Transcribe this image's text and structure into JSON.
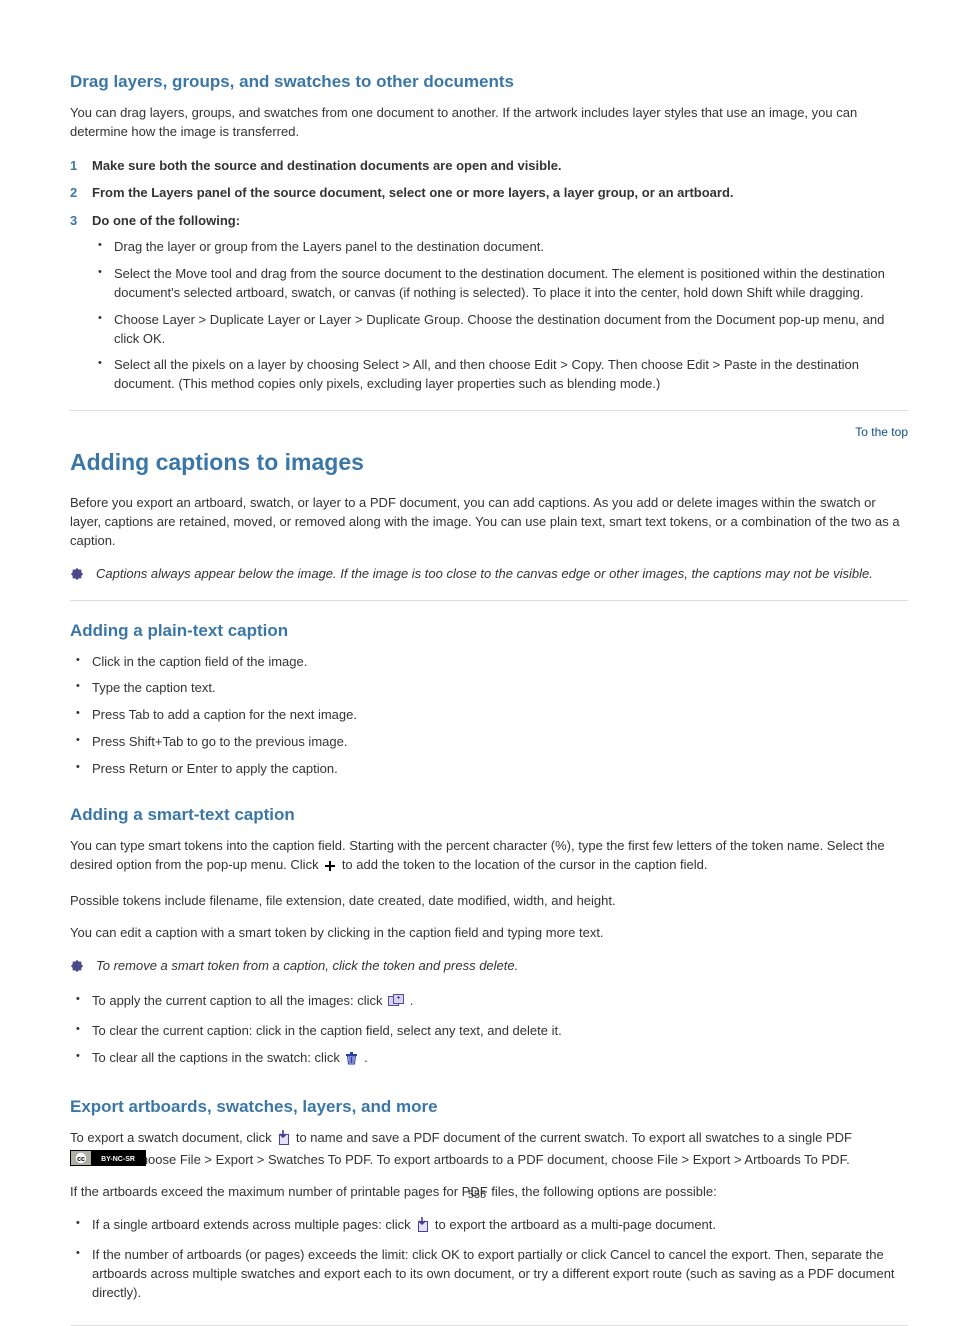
{
  "page_number": "555",
  "s1": {
    "title": "Drag layers, groups, and swatches to other documents",
    "intro": "You can drag layers, groups, and swatches from one document to another. If the artwork includes layer styles that use an image, you can determine how the image is transferred.",
    "steps": {
      "1": "Make sure both the source and destination documents are open and visible.",
      "2": "From the Layers panel of the source document, select one or more layers, a layer group, or an artboard.",
      "3": "Do one of the following:"
    },
    "substeps": [
      "Drag the layer or group from the Layers panel to the destination document.",
      "Select the Move tool and drag from the source document to the destination document. The element is positioned within the destination document's selected artboard, swatch, or canvas (if nothing is selected). To place it into the center, hold down Shift while dragging.",
      "Choose Layer > Duplicate Layer or Layer > Duplicate Group. Choose the destination document from the Document pop-up menu, and click OK.",
      "Select all the pixels on a layer by choosing Select > All, and then choose Edit > Copy. Then choose Edit > Paste in the destination document. (This method copies only pixels, excluding layer properties such as blending mode.)"
    ]
  },
  "top_link": "To the top",
  "s2": {
    "title": "Adding captions to images",
    "p1": "Before you export an artboard, swatch, or layer to a PDF document, you can add captions. As you add or delete images within the swatch or layer, captions are retained, moved, or removed along with the image. You can use plain text, smart text tokens, or a combination of the two as a caption.",
    "note": "Captions always appear below the image. If the image is too close to the canvas edge or other images, the captions may not be visible."
  },
  "s3": {
    "title": "Adding a plain-text caption",
    "bullets": [
      "Click in the caption field of the image.",
      "Type the caption text.",
      "Press Tab to add a caption for the next image.",
      "Press Shift+Tab to go to the previous image.",
      "Press Return or Enter to apply the caption."
    ]
  },
  "s4": {
    "title": "Adding a smart-text caption",
    "p1": "You can type smart tokens into the caption field. Starting with the percent character (%), type the first few letters of the token name. Select the desired option from the pop-up menu. Click ",
    "p1_after": " to add the token to the location of the cursor in the caption field.",
    "p2": "Possible tokens include filename, file extension, date created, date modified, width, and height.",
    "p3": "You can edit a caption with a smart token by clicking in the caption field and typing more text.",
    "note": "To remove a smart token from a caption, click the token and press delete.",
    "sub_bullets": {
      "0_pre": "To apply the current caption to all the images: click ",
      "0_post": ".",
      "1": "To clear the current caption: click in the caption field, select any text, and delete it.",
      "2_pre": "To clear all the captions in the swatch: click ",
      "2_post": "."
    }
  },
  "s5": {
    "title": "Export artboards, swatches, layers, and more",
    "p1_a": "To export a swatch document, click ",
    "p1_b": " to name and save a PDF document of the current swatch. To export all swatches to a single PDF document, choose File > Export > Swatches To PDF. To export artboards to a PDF document, choose File > Export > Artboards To PDF.",
    "p2": "If the artboards exceed the maximum number of printable pages for PDF files, the following options are possible:",
    "bullets": {
      "0_a": "If a single artboard extends across multiple pages: click ",
      "0_b": " to export the artboard as a multi-page document.",
      "1_a": "If the number of artboards (or pages) exceeds the limit: click OK to export partially or click Cancel to cancel the export. Then, separate the artboards across multiple swatches and export each to its own document, or try a different export route (such as saving as a PDF document directly)."
    }
  }
}
